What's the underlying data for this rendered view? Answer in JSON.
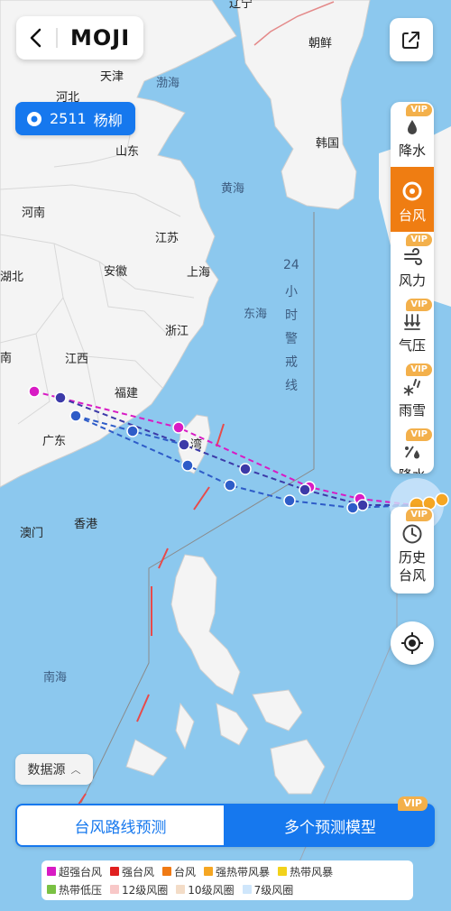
{
  "header": {
    "logo": "MOJI"
  },
  "storm": {
    "number": "2511",
    "name": "杨柳"
  },
  "map_labels": {
    "liaoning": "辽宁",
    "north_korea": "朝鲜",
    "tianjin": "天津",
    "bohai": "渤海",
    "hebei": "河北",
    "south_korea": "韩国",
    "shandong": "山东",
    "henan": "河南",
    "yellow_sea": "黄海",
    "jiangsu": "江苏",
    "hubei": "湖北",
    "anhui": "安徽",
    "shanghai": "上海",
    "east_sea": "东海",
    "zhejiang": "浙江",
    "hunan": "南",
    "jiangxi": "江西",
    "fujian": "福建",
    "guangdong": "广东",
    "taiwan": "湾",
    "macau": "澳门",
    "hongkong": "香港",
    "south_sea": "南海",
    "warning_line": "24小时警戒线"
  },
  "side_panel": {
    "items": [
      {
        "label": "降水",
        "icon": "rain-icon",
        "vip": "VIP",
        "active": false
      },
      {
        "label": "台风",
        "icon": "typhoon-icon",
        "vip": "",
        "active": true
      },
      {
        "label": "风力",
        "icon": "wind-icon",
        "vip": "VIP",
        "active": false
      },
      {
        "label": "气压",
        "icon": "pressure-icon",
        "vip": "VIP",
        "active": false
      },
      {
        "label": "雨雪",
        "icon": "rain-snow-icon",
        "vip": "VIP",
        "active": false
      },
      {
        "label": "降水",
        "icon": "precip-icon",
        "vip": "VIP",
        "active": false
      }
    ],
    "history": {
      "line1": "历史",
      "line2": "台风",
      "vip": "VIP"
    }
  },
  "data_source": {
    "label": "数据源"
  },
  "tabs": {
    "route_forecast": "台风路线预测",
    "multi_model": "多个预测模型",
    "vip": "VIP"
  },
  "legend": [
    {
      "label": "超强台风",
      "color": "#d81bc4"
    },
    {
      "label": "强台风",
      "color": "#e02020"
    },
    {
      "label": "台风",
      "color": "#f07a14"
    },
    {
      "label": "强热带风暴",
      "color": "#f5a623"
    },
    {
      "label": "热带风暴",
      "color": "#f2d21b"
    },
    {
      "label": "热带低压",
      "color": "#7ac143"
    },
    {
      "label": "12级风圈",
      "color": "#f8c8c8"
    },
    {
      "label": "10级风圈",
      "color": "#f3dcc7"
    },
    {
      "label": "7级风圈",
      "color": "#cfe6fb"
    }
  ],
  "colors": {
    "accent": "#1678ee",
    "active_tab": "#ef7d12",
    "vip": "#f3b04b"
  }
}
